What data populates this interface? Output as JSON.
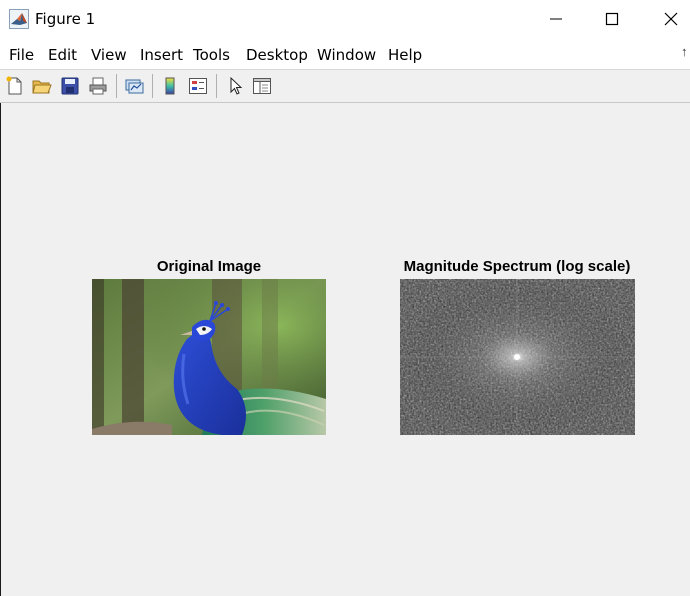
{
  "window": {
    "title": "Figure 1",
    "icon": "matlab-logo-icon"
  },
  "menu": {
    "items": [
      "File",
      "Edit",
      "View",
      "Insert",
      "Tools",
      "Desktop",
      "Window",
      "Help"
    ],
    "overflow_icon": "menu-overflow-arrow-icon"
  },
  "toolbar": {
    "tools": [
      "new-figure-icon",
      "open-file-icon",
      "save-icon",
      "print-icon",
      "link-plot-icon",
      "colorbar-icon",
      "legend-icon",
      "edit-plot-pointer-icon",
      "property-inspector-icon"
    ]
  },
  "figure": {
    "subplots": [
      {
        "title": "Original Image",
        "content": "photograph of a peacock"
      },
      {
        "title": "Magnitude Spectrum (log scale)",
        "content": "grayscale FFT magnitude spectrum"
      }
    ]
  },
  "colors": {
    "titlebar_bg": "#ffffff",
    "figure_bg": "#f0f0f0",
    "accent_matlab": "#e16737"
  }
}
